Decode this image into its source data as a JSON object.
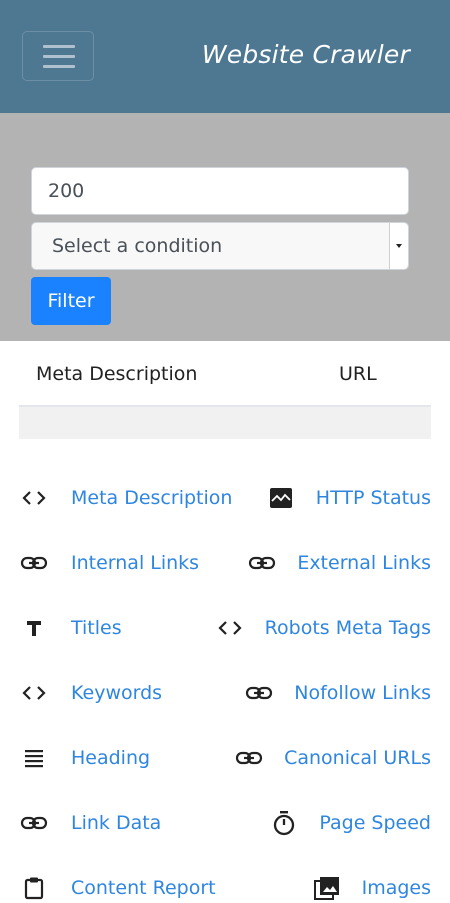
{
  "header": {
    "brand": "Website Crawler",
    "menu_toggle": "menu"
  },
  "filter": {
    "status_value": "200",
    "condition_placeholder": "Select a condition",
    "filter_button": "Filter"
  },
  "table": {
    "columns": [
      "Meta Description",
      "URL"
    ]
  },
  "nav": {
    "left": [
      {
        "label": "Meta Description",
        "icon": "code-icon"
      },
      {
        "label": "Internal Links",
        "icon": "link-icon"
      },
      {
        "label": "Titles",
        "icon": "title-icon"
      },
      {
        "label": "Keywords",
        "icon": "code-icon"
      },
      {
        "label": "Heading",
        "icon": "heading-lines-icon"
      },
      {
        "label": "Link Data",
        "icon": "link-icon"
      },
      {
        "label": "Content Report",
        "icon": "clipboard-icon"
      }
    ],
    "right": [
      {
        "label": "HTTP Status",
        "icon": "image-wave-icon"
      },
      {
        "label": "External Links",
        "icon": "link-icon"
      },
      {
        "label": "Robots Meta Tags",
        "icon": "code-icon"
      },
      {
        "label": "Nofollow Links",
        "icon": "link-icon"
      },
      {
        "label": "Canonical URLs",
        "icon": "link-icon"
      },
      {
        "label": "Page Speed",
        "icon": "timer-icon"
      },
      {
        "label": "Images",
        "icon": "images-icon"
      }
    ]
  },
  "colors": {
    "navbar": "#4e7792",
    "panel": "#b3b3b3",
    "accent": "#1a82ff",
    "link": "#2f86e0"
  }
}
